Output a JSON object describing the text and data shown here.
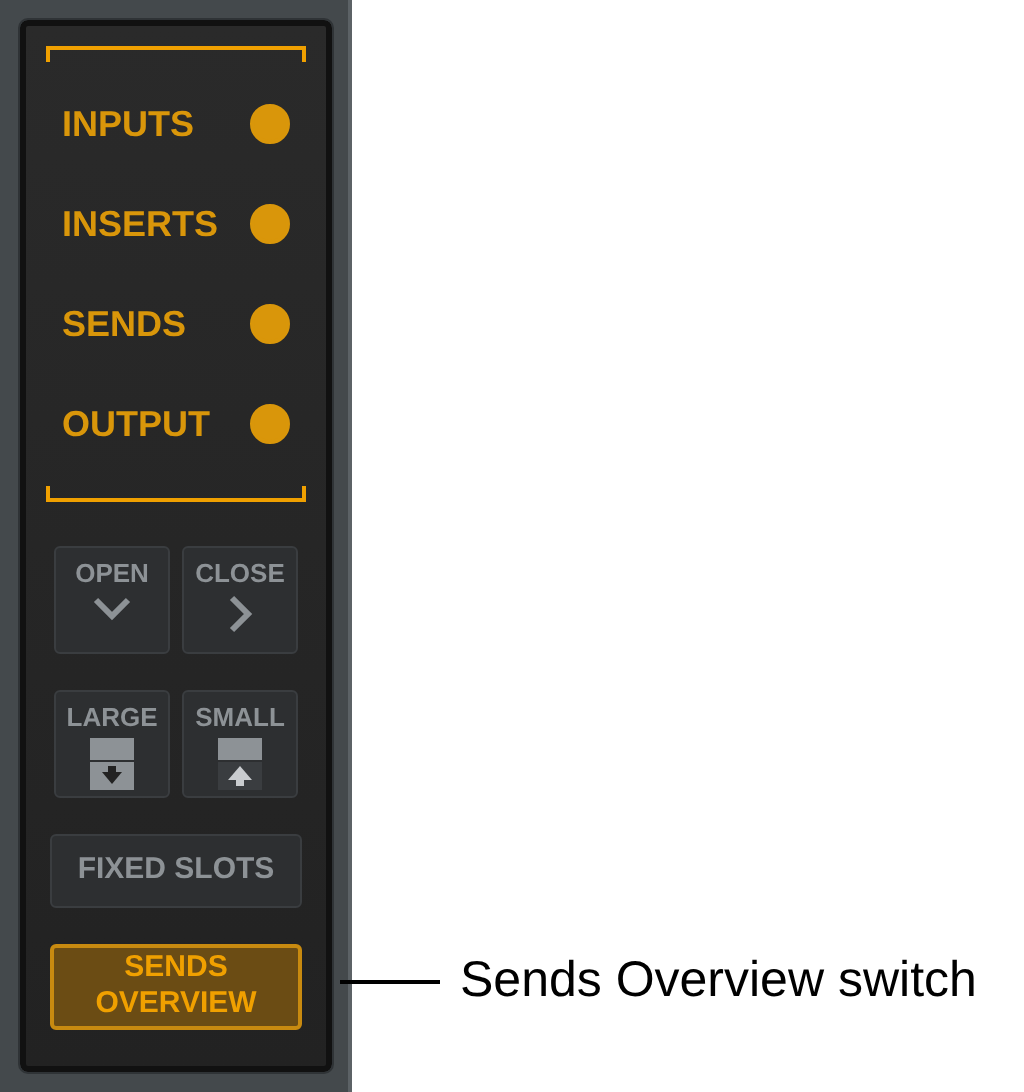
{
  "sections": [
    {
      "label": "INPUTS",
      "on": true
    },
    {
      "label": "INSERTS",
      "on": true
    },
    {
      "label": "SENDS",
      "on": true
    },
    {
      "label": "OUTPUT",
      "on": true
    }
  ],
  "button_pairs": [
    [
      {
        "label": "OPEN",
        "kind": "chevron-down"
      },
      {
        "label": "CLOSE",
        "kind": "chevron-right"
      }
    ],
    [
      {
        "label": "LARGE",
        "kind": "size-down"
      },
      {
        "label": "SMALL",
        "kind": "size-up"
      }
    ]
  ],
  "switches": [
    {
      "label": "FIXED SLOTS",
      "selected": false
    },
    {
      "label": "SENDS\nOVERVIEW",
      "selected": true
    }
  ],
  "callout": "Sends Overview switch"
}
